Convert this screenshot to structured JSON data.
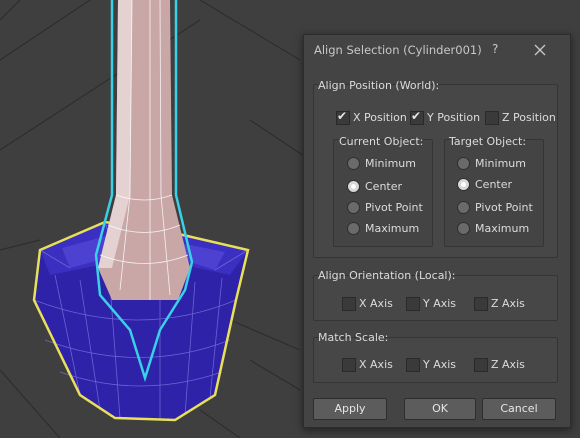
{
  "colors": {
    "mesh_fill": "#2d22a8",
    "selection_outline": "#e8e05a",
    "target_outline": "#3ad0e8",
    "cylinder": "#c9a7a7"
  },
  "dialog": {
    "title": "Align Selection (Cylinder001)",
    "help_label": "?",
    "close_icon": "close-icon",
    "align_position": {
      "label": "Align Position (World):",
      "x": {
        "label": "X Position",
        "checked": true
      },
      "y": {
        "label": "Y Position",
        "checked": true
      },
      "z": {
        "label": "Z Position",
        "checked": false
      },
      "current_object": {
        "label": "Current Object:",
        "options": [
          "Minimum",
          "Center",
          "Pivot Point",
          "Maximum"
        ],
        "selected": "Center"
      },
      "target_object": {
        "label": "Target Object:",
        "options": [
          "Minimum",
          "Center",
          "Pivot Point",
          "Maximum"
        ],
        "selected": "Center"
      }
    },
    "align_orientation": {
      "label": "Align Orientation (Local):",
      "x": {
        "label": "X Axis",
        "checked": false
      },
      "y": {
        "label": "Y Axis",
        "checked": false
      },
      "z": {
        "label": "Z Axis",
        "checked": false
      }
    },
    "match_scale": {
      "label": "Match Scale:",
      "x": {
        "label": "X Axis",
        "checked": false
      },
      "y": {
        "label": "Y Axis",
        "checked": false
      },
      "z": {
        "label": "Z Axis",
        "checked": false
      }
    },
    "buttons": {
      "apply": "Apply",
      "ok": "OK",
      "cancel": "Cancel"
    }
  }
}
